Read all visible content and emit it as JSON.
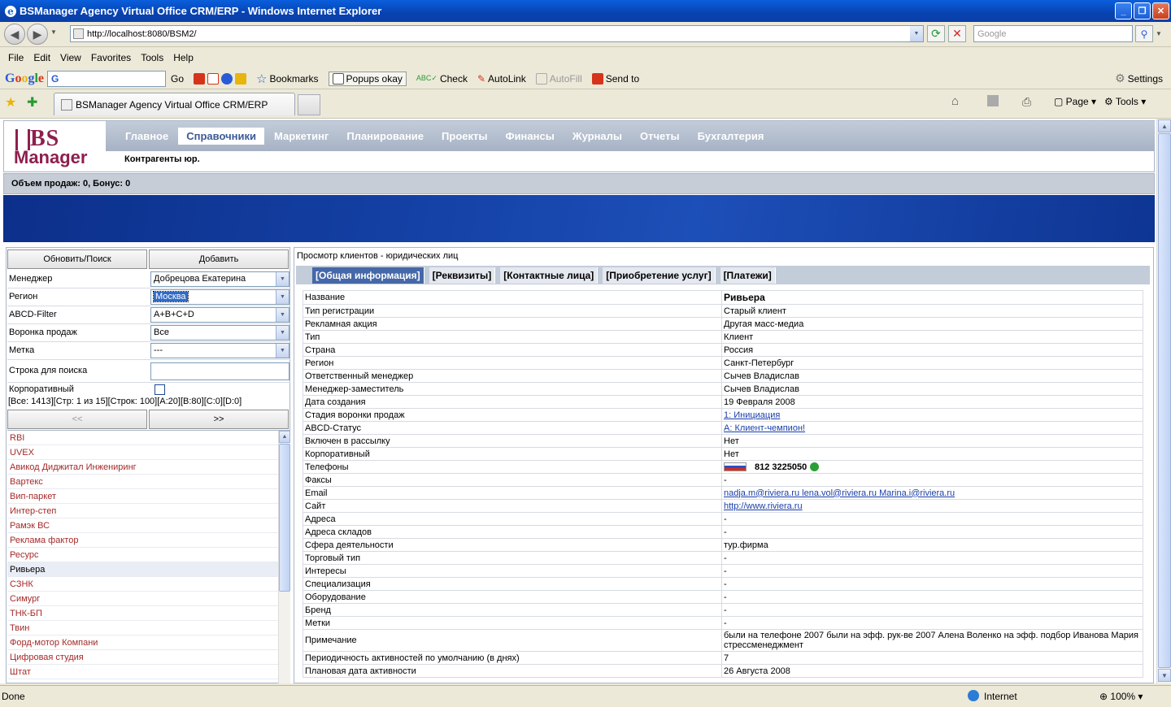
{
  "window": {
    "title": "BSManager Agency Virtual Office CRM/ERP - Windows Internet Explorer",
    "ie_letter": "e"
  },
  "address": {
    "url": "http://localhost:8080/BSM2/",
    "search_placeholder": "Google"
  },
  "menu": [
    "File",
    "Edit",
    "View",
    "Favorites",
    "Tools",
    "Help"
  ],
  "google_toolbar": {
    "logo": [
      "G",
      "o",
      "o",
      "g",
      "l",
      "e"
    ],
    "field_value": "G",
    "go_label": "Go",
    "bookmarks": "Bookmarks",
    "popups": "Popups okay",
    "check": "Check",
    "autolink": "AutoLink",
    "autofill": "AutoFill",
    "sendto": "Send to",
    "settings": "Settings"
  },
  "browser_tabs": {
    "active_tab": "BSManager Agency Virtual Office CRM/ERP",
    "page_btn": "Page",
    "tools_btn": "Tools"
  },
  "app": {
    "logo_top": "BS",
    "logo_bottom": "Manager",
    "nav": [
      "Главное",
      "Справочники",
      "Маркетинг",
      "Планирование",
      "Проекты",
      "Финансы",
      "Журналы",
      "Отчеты",
      "Бухгалтерия"
    ],
    "nav_active_index": 1,
    "subnav": "Контрагенты юр.",
    "sales": "Объем продаж: 0, Бонус: 0"
  },
  "left": {
    "refresh_button": "Обновить/Поиск",
    "add_button": "Добавить",
    "filters": [
      {
        "label": "Менеджер",
        "value": "Добрецова Екатерина"
      },
      {
        "label": "Регион",
        "value": "Москва"
      },
      {
        "label": "ABCD-Filter",
        "value": "A+B+C+D"
      },
      {
        "label": "Воронка продаж",
        "value": "Все"
      },
      {
        "label": "Метка",
        "value": "---"
      }
    ],
    "search_label": "Строка для поиска",
    "search_value": "",
    "corporate_label": "Корпоративный",
    "stats": "[Все: 1413][Стр: 1 из 15][Строк: 100][A:20][B:80][C:0][D:0]",
    "prev": "<<",
    "next": ">>",
    "items": [
      "RBI",
      "UVEX",
      "Авикод  Диджитал Инжениринг",
      "Вартекс",
      "Вип-паркет",
      "Интер-степ",
      "Рамэк ВС",
      "Реклама фактор",
      "Ресурс",
      "Ривьера",
      "СЗНК",
      "Симург",
      "ТНК-БП",
      "Твин",
      "Форд-мотор Компани",
      "Цифровая студия",
      "Штат"
    ],
    "selected_index": 9
  },
  "right": {
    "title": "Просмотр клиентов - юридических лиц",
    "tabs": [
      "[Общая информация]",
      "[Реквизиты]",
      "[Контактные лица]",
      "[Приобретение услуг]",
      "[Платежи]"
    ],
    "active_tab": 0,
    "rows": [
      {
        "k": "Название",
        "v": "Ривьера",
        "bold": true
      },
      {
        "k": "Тип регистрации",
        "v": "Старый клиент"
      },
      {
        "k": "Рекламная акция",
        "v": "Другая масс-медиа"
      },
      {
        "k": "Тип",
        "v": "Клиент"
      },
      {
        "k": "Страна",
        "v": "Россия"
      },
      {
        "k": "Регион",
        "v": "Санкт-Петербург"
      },
      {
        "k": "Ответственный менеджер",
        "v": "Сычев Владислав"
      },
      {
        "k": "Менеджер-заместитель",
        "v": "Сычев Владислав"
      },
      {
        "k": "Дата создания",
        "v": "19 Февраля 2008"
      },
      {
        "k": "Стадия воронки продаж",
        "v": "1: Инициация",
        "link": true
      },
      {
        "k": "ABCD-Статус",
        "v": "A: Клиент-чемпион!",
        "link": true
      },
      {
        "k": "Включен в рассылку",
        "v": "Нет"
      },
      {
        "k": "Корпоративный",
        "v": "Нет"
      },
      {
        "k": "Телефоны",
        "v": "812 3225050",
        "phone": true
      },
      {
        "k": "Факсы",
        "v": "-"
      },
      {
        "k": "Email",
        "v": "nadja.m@riviera.ru lena.vol@riviera.ru Marina.i@riviera.ru",
        "link": true
      },
      {
        "k": "Сайт",
        "v": "http://www.riviera.ru",
        "link": true
      },
      {
        "k": "Адреса",
        "v": "-"
      },
      {
        "k": "Адреса складов",
        "v": "-"
      },
      {
        "k": "Сфера деятельности",
        "v": "тур.фирма"
      },
      {
        "k": "Торговый тип",
        "v": "-"
      },
      {
        "k": "Интересы",
        "v": "-"
      },
      {
        "k": "Специализация",
        "v": "-"
      },
      {
        "k": "Оборудование",
        "v": "-"
      },
      {
        "k": "Бренд",
        "v": "-"
      },
      {
        "k": "Метки",
        "v": "-"
      },
      {
        "k": "Примечание",
        "v": "были на телефоне 2007   были на эфф. рук-ве 2007   Алена Воленко на эфф. подбор   Иванова Мария стрессменеджмент"
      },
      {
        "k": "Периодичность активностей по умолчанию (в днях)",
        "v": "7"
      },
      {
        "k": "Плановая дата активности",
        "v": "26 Августа 2008"
      }
    ]
  },
  "status": {
    "left": "Done",
    "zone": "Internet",
    "zoom": "100%"
  }
}
